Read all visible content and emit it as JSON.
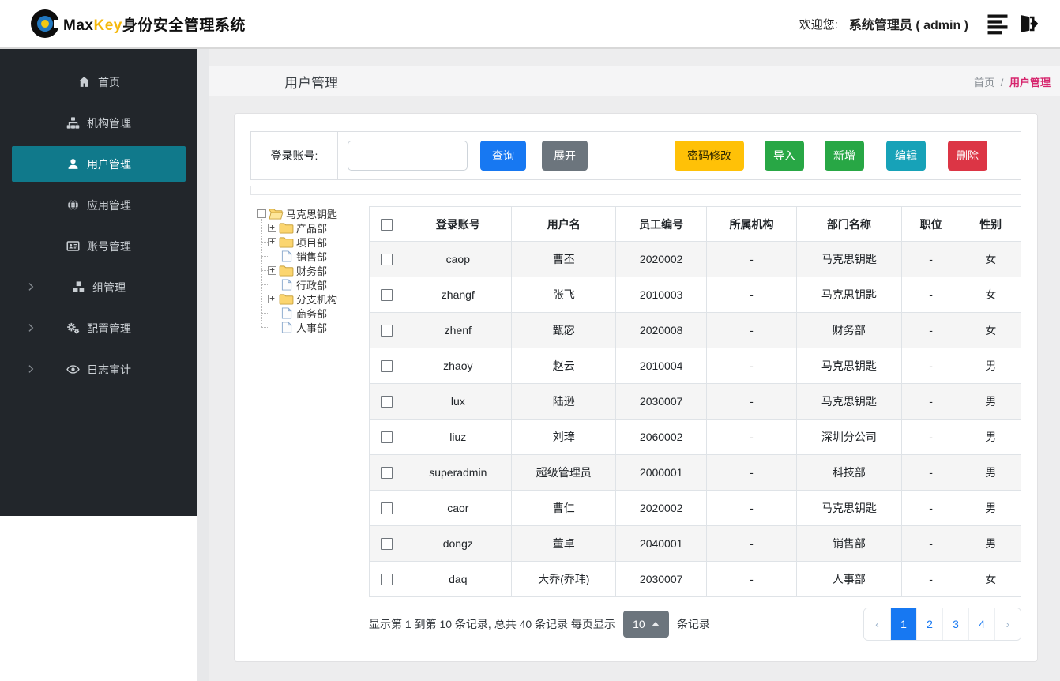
{
  "topbar": {
    "brand_max": "Max",
    "brand_key": "Key",
    "brand_suffix": "身份安全管理系统",
    "welcome_label": "欢迎您:",
    "user_display": "系统管理员 ( admin )"
  },
  "sidebar": {
    "items": [
      {
        "label": "首页",
        "icon": "home-icon",
        "active": false,
        "expandable": false
      },
      {
        "label": "机构管理",
        "icon": "sitemap-icon",
        "active": false,
        "expandable": false
      },
      {
        "label": "用户管理",
        "icon": "user-icon",
        "active": true,
        "expandable": false
      },
      {
        "label": "应用管理",
        "icon": "globe-icon",
        "active": false,
        "expandable": false
      },
      {
        "label": "账号管理",
        "icon": "id-card-icon",
        "active": false,
        "expandable": false
      },
      {
        "label": "组管理",
        "icon": "cubes-icon",
        "active": false,
        "expandable": true
      },
      {
        "label": "配置管理",
        "icon": "gears-icon",
        "active": false,
        "expandable": true
      },
      {
        "label": "日志审计",
        "icon": "eye-icon",
        "active": false,
        "expandable": true
      }
    ]
  },
  "page": {
    "title": "用户管理",
    "breadcrumb_home": "首页",
    "breadcrumb_sep": "/",
    "breadcrumb_current": "用户管理"
  },
  "search": {
    "label": "登录账号:",
    "value": "",
    "query_button": "查询",
    "expand_button": "展开"
  },
  "actions": {
    "change_password": "密码修改",
    "import": "导入",
    "add": "新增",
    "edit": "编辑",
    "delete": "删除"
  },
  "colors": {
    "primary": "#1778f2",
    "warning": "#ffc107",
    "success": "#28a745",
    "info": "#17a2b8",
    "danger": "#dc3545",
    "active_menu": "#10798b",
    "breadcrumb_active": "#d6256d"
  },
  "tree": {
    "root": "马克思钥匙",
    "children": [
      {
        "label": "产品部",
        "type": "folder"
      },
      {
        "label": "项目部",
        "type": "folder"
      },
      {
        "label": "销售部",
        "type": "leaf"
      },
      {
        "label": "财务部",
        "type": "folder"
      },
      {
        "label": "行政部",
        "type": "leaf"
      },
      {
        "label": "分支机构",
        "type": "folder"
      },
      {
        "label": "商务部",
        "type": "leaf"
      },
      {
        "label": "人事部",
        "type": "leaf"
      }
    ]
  },
  "table": {
    "headers": [
      "登录账号",
      "用户名",
      "员工编号",
      "所属机构",
      "部门名称",
      "职位",
      "性别"
    ],
    "rows": [
      {
        "cells": [
          "caop",
          "曹丕",
          "2020002",
          "-",
          "马克思钥匙",
          "-",
          "女"
        ]
      },
      {
        "cells": [
          "zhangf",
          "张飞",
          "2010003",
          "-",
          "马克思钥匙",
          "-",
          "女"
        ]
      },
      {
        "cells": [
          "zhenf",
          "甄宓",
          "2020008",
          "-",
          "财务部",
          "-",
          "女"
        ]
      },
      {
        "cells": [
          "zhaoy",
          "赵云",
          "2010004",
          "-",
          "马克思钥匙",
          "-",
          "男"
        ]
      },
      {
        "cells": [
          "lux",
          "陆逊",
          "2030007",
          "-",
          "马克思钥匙",
          "-",
          "男"
        ]
      },
      {
        "cells": [
          "liuz",
          "刘璋",
          "2060002",
          "-",
          "深圳分公司",
          "-",
          "男"
        ]
      },
      {
        "cells": [
          "superadmin",
          "超级管理员",
          "2000001",
          "-",
          "科技部",
          "-",
          "男"
        ]
      },
      {
        "cells": [
          "caor",
          "曹仁",
          "2020002",
          "-",
          "马克思钥匙",
          "-",
          "男"
        ]
      },
      {
        "cells": [
          "dongz",
          "董卓",
          "2040001",
          "-",
          "销售部",
          "-",
          "男"
        ]
      },
      {
        "cells": [
          "daq",
          "大乔(乔玮)",
          "2030007",
          "-",
          "人事部",
          "-",
          "女"
        ]
      }
    ]
  },
  "pagination": {
    "summary": "显示第 1 到第 10 条记录, 总共 40 条记录 每页显示",
    "page_size": "10",
    "suffix": "条记录",
    "prev": "‹",
    "next": "›",
    "pages": [
      "1",
      "2",
      "3",
      "4"
    ],
    "active_page": "1"
  }
}
